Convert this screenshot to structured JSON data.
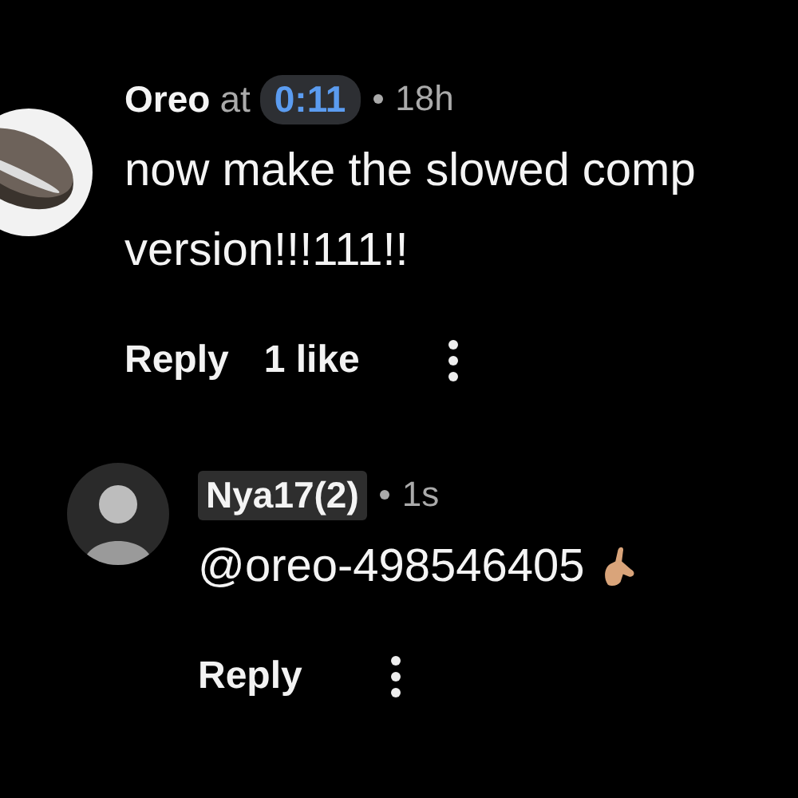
{
  "comments": [
    {
      "avatar": {
        "kind": "cookie"
      },
      "author": "Oreo",
      "author_highlighted": false,
      "at_label": "at",
      "timestamp": "0:11",
      "age": "18h",
      "body_lines": [
        "now make the slowed comp",
        "version!!!111!!"
      ],
      "reply_label": "Reply",
      "likes": "1 like",
      "nested": false,
      "emoji": false
    },
    {
      "avatar": {
        "kind": "person"
      },
      "author": "Nya17(2)",
      "author_highlighted": true,
      "age": "1s",
      "body_lines": [
        "@oreo-498546405"
      ],
      "reply_label": "Reply",
      "nested": true,
      "emoji": true
    }
  ]
}
